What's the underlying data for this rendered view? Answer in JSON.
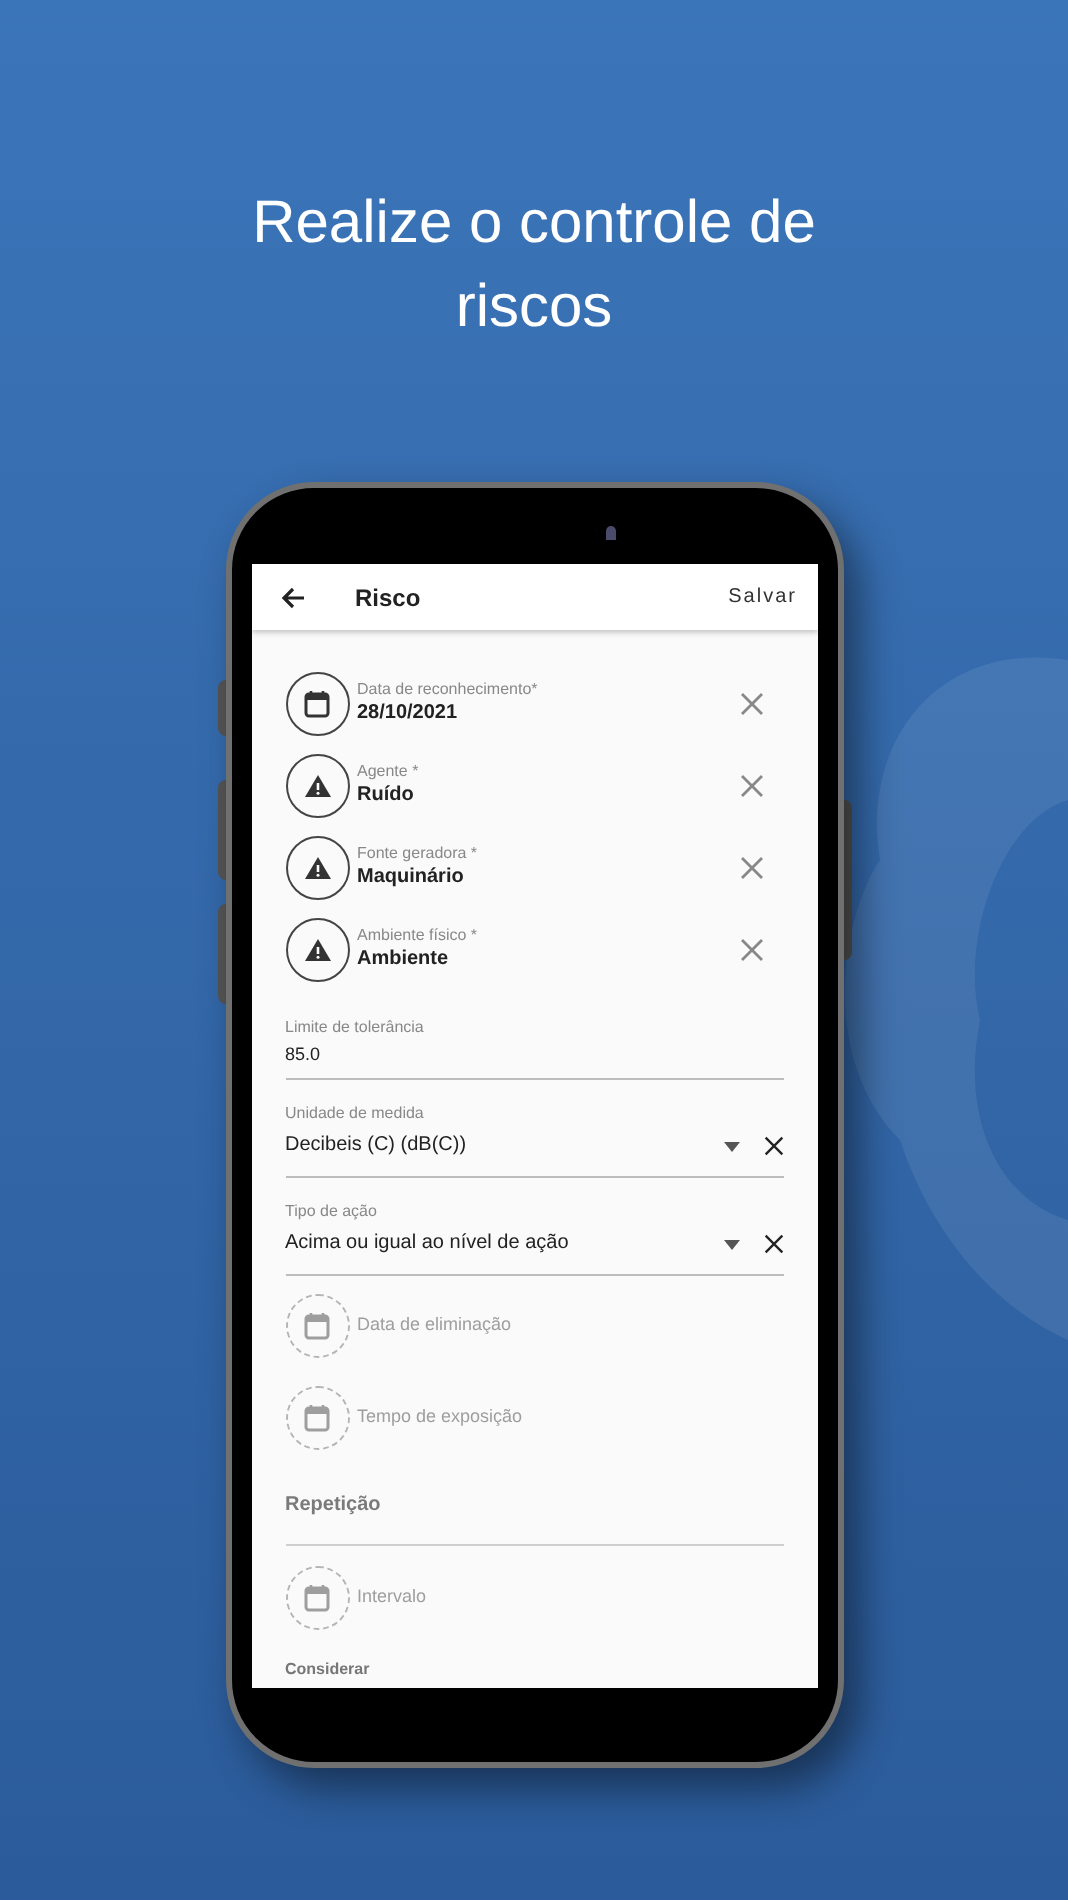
{
  "headline": "Realize o controle de riscos",
  "app_bar": {
    "title": "Risco",
    "action": "Salvar"
  },
  "fields": [
    {
      "kind": "date_picker",
      "label": "Data de reconhecimento*",
      "value": "28/10/2021"
    },
    {
      "kind": "lookup",
      "label": "Agente *",
      "value": "Ruído"
    },
    {
      "kind": "lookup",
      "label": "Fonte geradora *",
      "value": "Maquinário"
    },
    {
      "kind": "lookup",
      "label": "Ambiente físico *",
      "value": "Ambiente"
    },
    {
      "kind": "text",
      "label": "Limite de tolerância",
      "value": "85.0"
    },
    {
      "kind": "dropdown",
      "label": "Unidade de medida",
      "value": "Decibeis (C) (dB(C))"
    },
    {
      "kind": "dropdown",
      "label": "Tipo de ação",
      "value": "Acima ou igual ao nível de ação"
    },
    {
      "kind": "date_picker",
      "label": "Data de eliminação"
    },
    {
      "kind": "date_picker",
      "label": "Tempo de exposição"
    },
    {
      "kind": "section",
      "label": "Repetição"
    },
    {
      "kind": "date_picker",
      "label": "Intervalo"
    },
    {
      "kind": "subheading",
      "label": "Considerar"
    }
  ]
}
